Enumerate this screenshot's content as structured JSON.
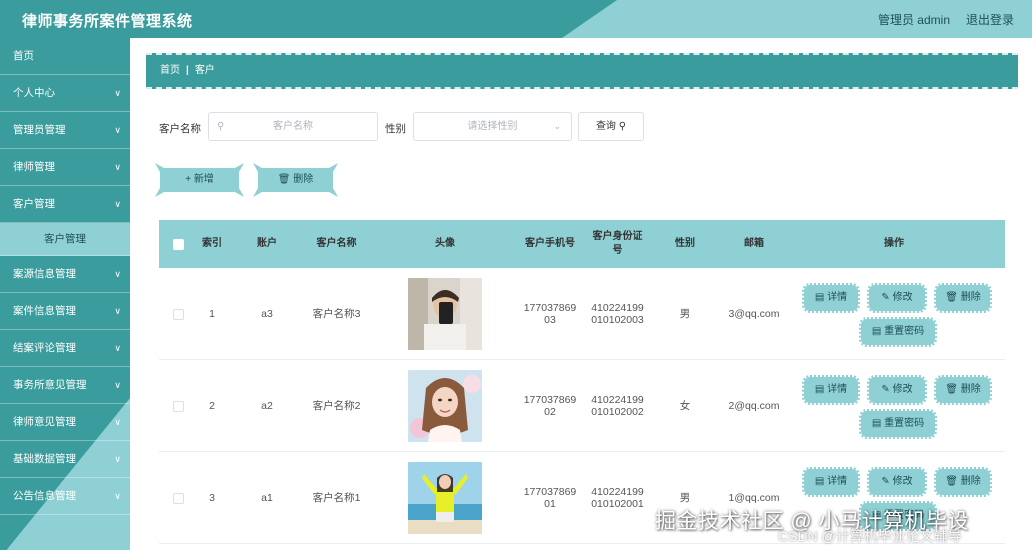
{
  "header": {
    "title": "律师事务所案件管理系统",
    "user_label": "管理员 admin",
    "logout_label": "退出登录"
  },
  "sidebar": {
    "items": [
      {
        "label": "首页",
        "has_chevron": false
      },
      {
        "label": "个人中心",
        "has_chevron": true
      },
      {
        "label": "管理员管理",
        "has_chevron": true
      },
      {
        "label": "律师管理",
        "has_chevron": true
      },
      {
        "label": "客户管理",
        "has_chevron": true
      }
    ],
    "active_sub": "客户管理",
    "items_after": [
      {
        "label": "案源信息管理",
        "has_chevron": true
      },
      {
        "label": "案件信息管理",
        "has_chevron": true
      },
      {
        "label": "结案评论管理",
        "has_chevron": true
      },
      {
        "label": "事务所意见管理",
        "has_chevron": true
      },
      {
        "label": "律师意见管理",
        "has_chevron": true
      },
      {
        "label": "基础数据管理",
        "has_chevron": true
      },
      {
        "label": "公告信息管理",
        "has_chevron": true
      }
    ]
  },
  "breadcrumb": {
    "home": "首页",
    "current": "客户"
  },
  "search": {
    "name_label": "客户名称",
    "name_placeholder": "客户名称",
    "gender_label": "性别",
    "gender_placeholder": "请选择性别",
    "search_button": "查询"
  },
  "actions": {
    "add_label": "新增",
    "delete_label": "删除"
  },
  "table": {
    "headers": {
      "index": "索引",
      "account": "账户",
      "name": "客户名称",
      "avatar": "头像",
      "phone": "客户手机号",
      "id_card": "客户身份证号",
      "gender": "性别",
      "email": "邮箱",
      "ops": "操作"
    },
    "op_labels": {
      "detail": "详情",
      "edit": "修改",
      "delete": "删除",
      "reset": "重置密码"
    },
    "rows": [
      {
        "index": "1",
        "account": "a3",
        "name": "客户名称3",
        "phone": "17703786903",
        "id_card": "410224199010102003",
        "gender": "男",
        "email": "3@qq.com"
      },
      {
        "index": "2",
        "account": "a2",
        "name": "客户名称2",
        "phone": "17703786902",
        "id_card": "410224199010102002",
        "gender": "女",
        "email": "2@qq.com"
      },
      {
        "index": "3",
        "account": "a1",
        "name": "客户名称1",
        "phone": "17703786901",
        "id_card": "410224199010102001",
        "gender": "男",
        "email": "1@qq.com"
      }
    ]
  },
  "watermark": {
    "line1": "掘金技术社区 @ 小马计算机毕设",
    "line2": "CSDN @计算机毕业论文辅导"
  },
  "colors": {
    "primary": "#3a9c9c",
    "light": "#8ed0d4"
  }
}
